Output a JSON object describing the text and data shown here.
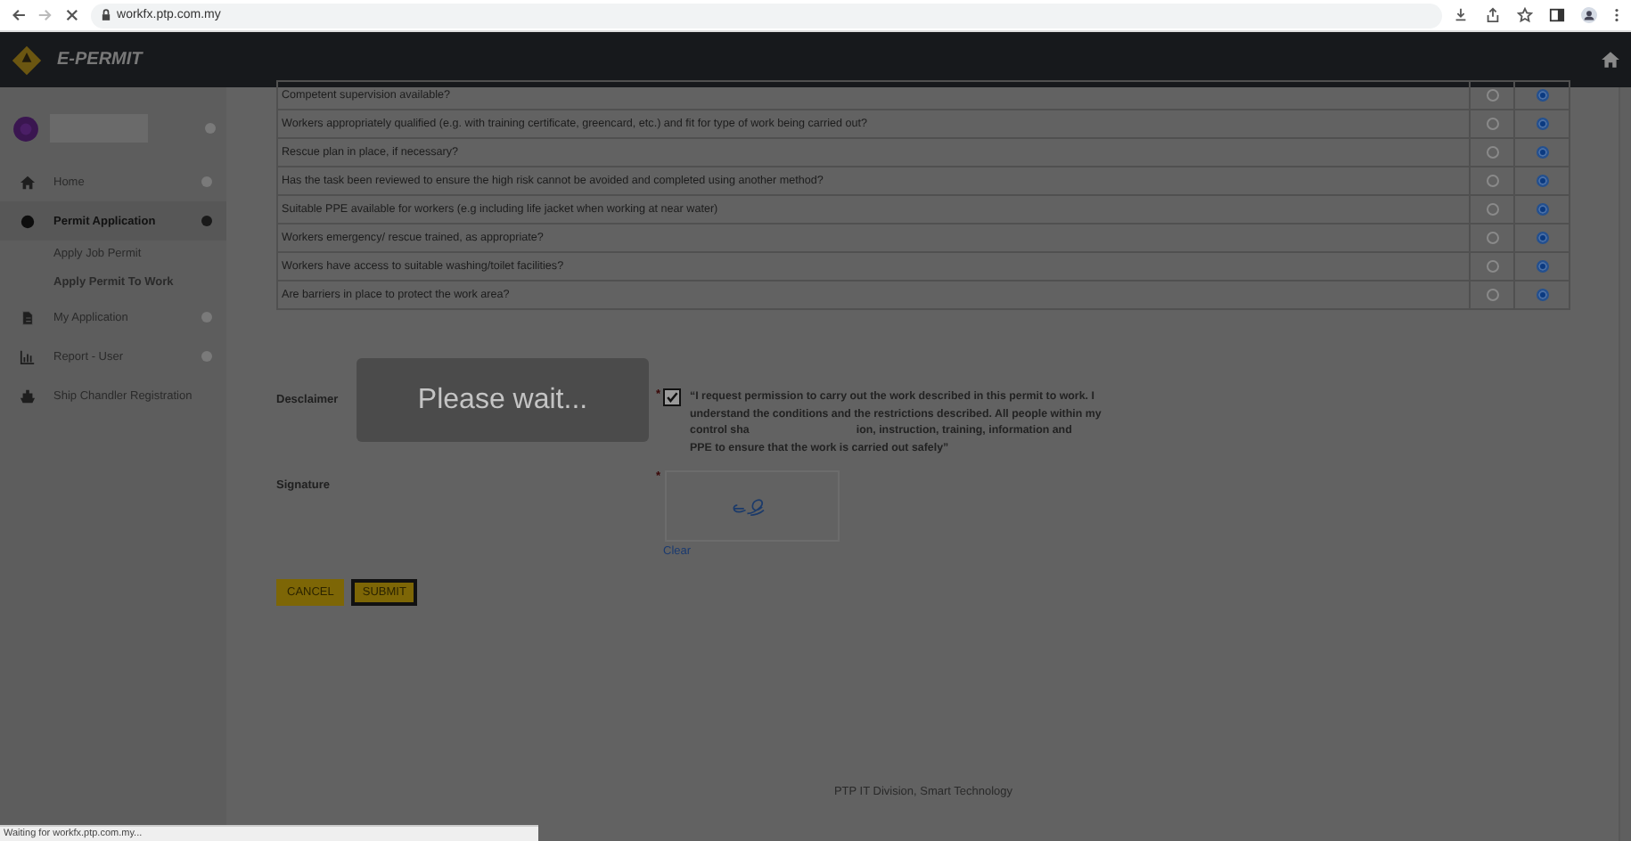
{
  "browser": {
    "url": "workfx.ptp.com.my",
    "forward_disabled": true
  },
  "header": {
    "title": "E-PERMIT"
  },
  "sidebar": {
    "items": [
      {
        "label": "Home",
        "kind": "home",
        "selected": false,
        "expanded": false
      },
      {
        "label": "Permit Application",
        "kind": "dot",
        "selected": true,
        "expanded": true,
        "children": [
          {
            "label": "Apply Job Permit",
            "selected": false
          },
          {
            "label": "Apply Permit To Work",
            "selected": true
          }
        ]
      },
      {
        "label": "My Application",
        "kind": "doc",
        "selected": false,
        "expanded": false
      },
      {
        "label": "Report - User",
        "kind": "chart",
        "selected": false,
        "expanded": false
      },
      {
        "label": "Ship Chandler Registration",
        "kind": "ship",
        "selected": false
      }
    ]
  },
  "checklist": [
    {
      "question": "Competent supervision available?",
      "options": [
        {
          "selected": false
        },
        {
          "selected": true
        }
      ]
    },
    {
      "question": "Workers appropriately qualified (e.g. with training certificate, greencard, etc.) and fit for type of work being carried out?",
      "options": [
        {
          "selected": false
        },
        {
          "selected": true
        }
      ]
    },
    {
      "question": "Rescue plan in place, if necessary?",
      "options": [
        {
          "selected": false
        },
        {
          "selected": true
        }
      ]
    },
    {
      "question": "Has the task been reviewed to ensure the high risk cannot be avoided and completed using another method?",
      "options": [
        {
          "selected": false
        },
        {
          "selected": true
        }
      ]
    },
    {
      "question": "Suitable PPE available for workers (e.g including life jacket when working at near water)",
      "options": [
        {
          "selected": false
        },
        {
          "selected": true
        }
      ]
    },
    {
      "question": "Workers emergency/ rescue trained, as appropriate?",
      "options": [
        {
          "selected": false
        },
        {
          "selected": true
        }
      ]
    },
    {
      "question": "Workers have access to suitable washing/toilet facilities?",
      "options": [
        {
          "selected": false
        },
        {
          "selected": true
        }
      ]
    },
    {
      "question": "Are barriers in place to protect the work area?",
      "options": [
        {
          "selected": false
        },
        {
          "selected": true
        }
      ]
    }
  ],
  "disclaimer": {
    "label": "Desclaimer",
    "required_mark": "*",
    "checked": true,
    "lines": [
      [
        "“I request permission to carry out the work described in this permit to work. I"
      ],
      [
        "understand the conditions and the restrictions described. All people within my"
      ],
      [
        "control sha",
        "ion, instruction, training, information and"
      ],
      [
        "PPE to ensure that the work is carried out safely”"
      ]
    ]
  },
  "signature": {
    "label": "Signature",
    "required_mark": "*",
    "clear": "Clear"
  },
  "buttons": [
    {
      "label": "CANCEL",
      "kind": "plain"
    },
    {
      "label": "SUBMIT",
      "kind": "outlined"
    }
  ],
  "loading": {
    "message": "Please wait..."
  },
  "footer": "PTP IT Division, Smart Technology",
  "status_bar": "Waiting for workfx.ptp.com.my..."
}
